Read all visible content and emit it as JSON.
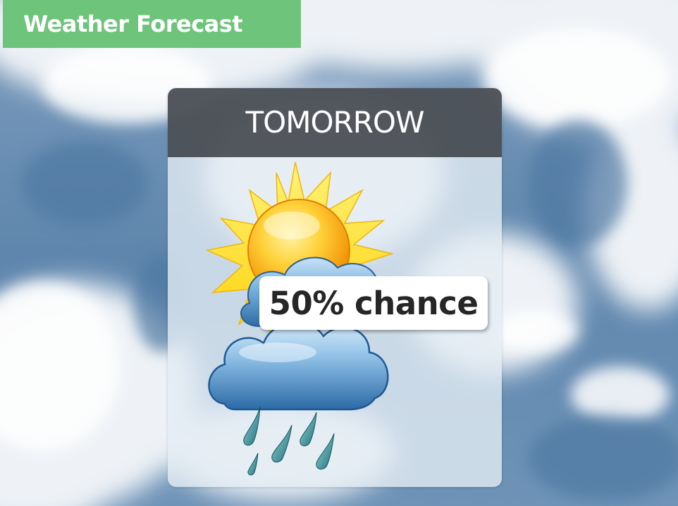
{
  "app": {
    "title": "Weather Forecast"
  },
  "forecast": {
    "day": "TOMORROW",
    "precipitation": "50% chance",
    "icon": "sun-cloud-rain-icon"
  },
  "colors": {
    "header_green": "#6dc47a",
    "card_header": "#32363c",
    "sky_blue": "#5f86ad"
  }
}
